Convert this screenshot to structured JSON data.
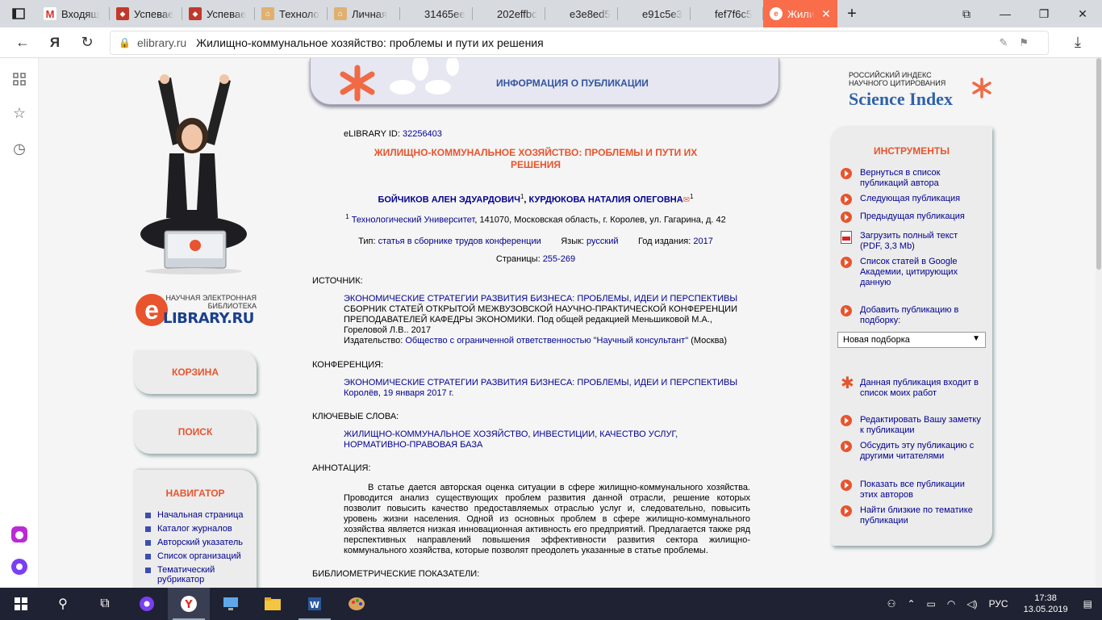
{
  "browser": {
    "tabs": [
      {
        "label": "Входящ",
        "icon": "gmail-icon",
        "color": "#ffffff"
      },
      {
        "label": "Успевае",
        "icon": "school-icon",
        "color": "#c0392b"
      },
      {
        "label": "Успевае",
        "icon": "school-icon",
        "color": "#c0392b"
      },
      {
        "label": "Техноло",
        "icon": "university-icon",
        "color": "#e0b070"
      },
      {
        "label": "Личная",
        "icon": "university-icon",
        "color": "#e0b070"
      },
      {
        "label": "31465ee",
        "icon": "page-icon",
        "color": "#d7dadf"
      },
      {
        "label": "202effbc",
        "icon": "page-icon",
        "color": "#d7dadf"
      },
      {
        "label": "e3e8ed5",
        "icon": "page-icon",
        "color": "#d7dadf"
      },
      {
        "label": "e91c5e3",
        "icon": "page-icon",
        "color": "#d7dadf"
      },
      {
        "label": "fef7f6c5",
        "icon": "page-icon",
        "color": "#d7dadf"
      }
    ],
    "active_tab": {
      "label": "Жили",
      "icon": "elibrary-icon"
    },
    "url_host": "elibrary.ru",
    "page_title": "Жилищно-коммунальное хозяйство: проблемы и пути их решения"
  },
  "header": {
    "title": "ИНФОРМАЦИЯ О ПУБЛИКАЦИИ"
  },
  "left": {
    "logo_sub": "НАУЧНАЯ ЭЛЕКТРОННАЯ БИБЛИОТЕКА",
    "logo_big": "LIBRARY.RU",
    "logo_letter": "e",
    "cart": "КОРЗИНА",
    "search": "ПОИСК",
    "nav_title": "НАВИГАТОР",
    "nav_items": [
      "Начальная страница",
      "Каталог журналов",
      "Авторский указатель",
      "Список организаций",
      "Тематический рубрикатор"
    ]
  },
  "pub": {
    "id_label": "eLIBRARY ID:",
    "id": "32256403",
    "title_line1": "ЖИЛИЩНО-КОММУНАЛЬНОЕ ХОЗЯЙСТВО: ПРОБЛЕМЫ И ПУТИ ИХ",
    "title_line2": "РЕШЕНИЯ",
    "author1": "БОЙЧИКОВ АЛЕН ЭДУАРДОВИЧ",
    "author2": "КУРДЮКОВА НАТАЛИЯ ОЛЕГОВНА",
    "sup": "1",
    "aff_org": "Технологический Университет",
    "aff_rest": ", 141070, Московская область, г. Королев, ул. Гагарина, д. 42",
    "type_label": "Тип:",
    "type": "статья в сборнике трудов конференции",
    "lang_label": "Язык:",
    "lang": "русский",
    "year_label": "Год издания:",
    "year": "2017",
    "pages_label": "Страницы:",
    "pages": "255-269",
    "source_label": "ИСТОЧНИК:",
    "source_link": "ЭКОНОМИЧЕСКИЕ СТРАТЕГИИ РАЗВИТИЯ БИЗНЕСА: ПРОБЛЕМЫ, ИДЕИ И ПЕРСПЕКТИВЫ",
    "source_desc": "СБОРНИК СТАТЕЙ ОТКРЫТОЙ МЕЖВУЗОВСКОЙ НАУЧНО-ПРАКТИЧЕСКОЙ КОНФЕРЕНЦИИ ПРЕПОДАВАТЕЛЕЙ КАФЕДРЫ ЭКОНОМИКИ. Под общей редакцией Меньшиковой М.А., Гореловой Л.В.. 2017",
    "publisher_label": "Издательство:",
    "publisher": "Общество с ограниченной ответственностью \"Научный консультант\"",
    "publisher_city": "(Москва)",
    "conf_label": "КОНФЕРЕНЦИЯ:",
    "conf_name": "ЭКОНОМИЧЕСКИЕ СТРАТЕГИИ РАЗВИТИЯ БИЗНЕСА: ПРОБЛЕМЫ, ИДЕИ И ПЕРСПЕКТИВЫ",
    "conf_place": "Королёв, 19 января 2017 г.",
    "kw_label": "КЛЮЧЕВЫЕ СЛОВА:",
    "kw": "ЖИЛИЩНО-КОММУНАЛЬНОЕ ХОЗЯЙСТВО, ИНВЕСТИЦИИ, КАЧЕСТВО УСЛУГ, НОРМАТИВНО-ПРАВОВАЯ БАЗА",
    "abs_label": "АННОТАЦИЯ:",
    "abstract": "В статье дается авторская оценка ситуации в сфере жилищно-коммунального хозяйства. Проводится анализ существующих проблем развития данной отрасли, решение которых позволит повысить качество предоставляемых отраслью услуг и, следовательно, повысить уровень жизни населения. Одной из основных проблем в сфере жилищно-коммунального хозяйства является низкая инновационная активность его предприятий. Предлагается также ряд перспективных направлений повышения эффективности развития сектора жилищно-коммунального хозяйства, которые позволят преодолеть указанные в статье проблемы.",
    "biblio_label": "БИБЛИОМЕТРИЧЕСКИЕ ПОКАЗАТЕЛИ:"
  },
  "right": {
    "sci_line1": "РОССИЙСКИЙ ИНДЕКС",
    "sci_line2": "НАУЧНОГО ЦИТИРОВАНИЯ",
    "sci_big": "Science Index",
    "tools_title": "ИНСТРУМЕНТЫ",
    "tools": [
      "Вернуться в список публикаций автора",
      "Следующая публикация",
      "Предыдущая публикация",
      "Загрузить полный текст (PDF, 3,3 Mb)",
      "Список статей в Google Академии, цитирующих данную",
      "Добавить публикацию в подборку:",
      "Данная публикация входит в список моих работ",
      "Редактировать Вашу заметку к публикации",
      "Обсудить эту публикацию с другими читателями",
      "Показать все публикации этих авторов",
      "Найти близкие по тематике публикации"
    ],
    "select_value": "Новая подборка"
  },
  "taskbar": {
    "lang": "РУС",
    "time": "17:38",
    "date": "13.05.2019"
  },
  "colors": {
    "accent": "#e8542d",
    "link": "#00008f",
    "tab_active": "#fa6d4b"
  }
}
